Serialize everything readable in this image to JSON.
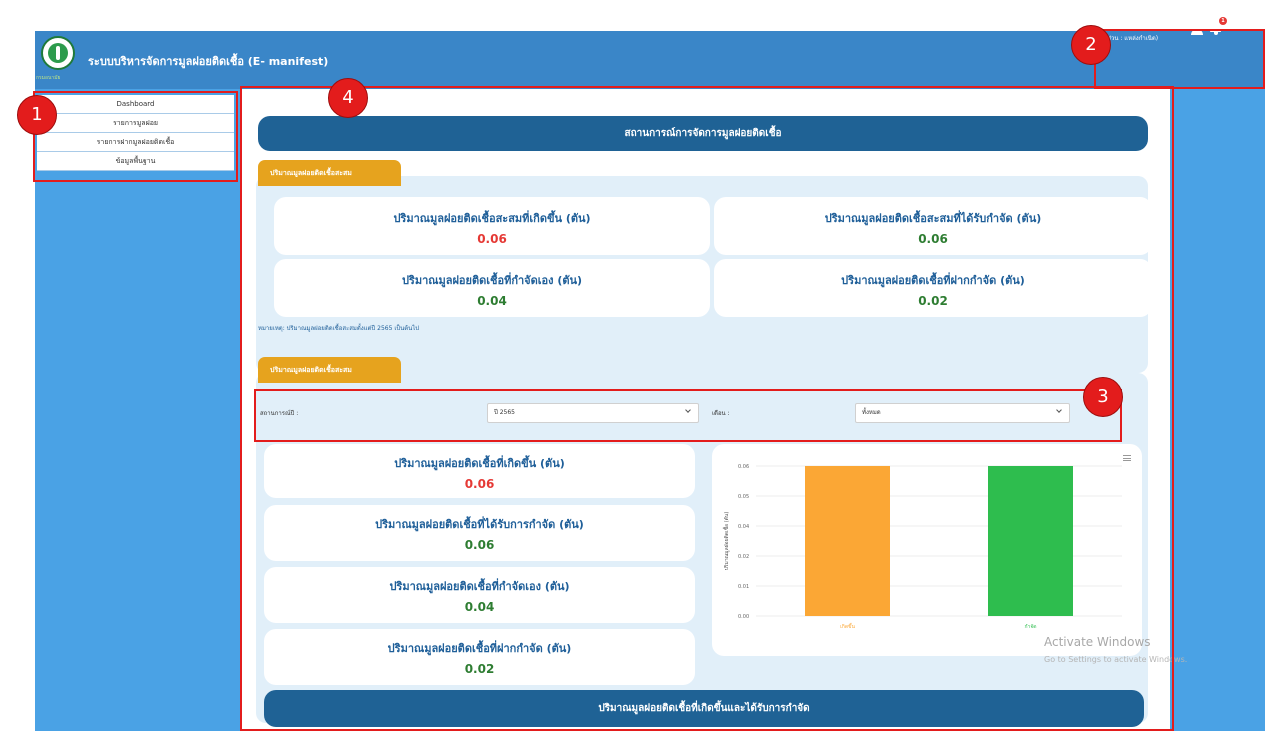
{
  "header": {
    "title": "ระบบบริหารจัดการมูลฝอยติดเชื้อ (E- manifest)",
    "logo_caption": "กรมอนามัย",
    "user_role": "STAFF",
    "user_dept": "(ส่วน : แหล่งกำเนิด)",
    "notification_count": "1"
  },
  "sidebar": {
    "items": [
      {
        "label": "Dashboard"
      },
      {
        "label": "รายการมูลฝอย"
      },
      {
        "label": "รายการฝากมูลฝอยติดเชื้อ"
      },
      {
        "label": "ข้อมูลพื้นฐาน"
      }
    ]
  },
  "main": {
    "banner_title": "สถานการณ์การจัดการมูลฝอยติดเชื้อ",
    "accumulated": {
      "tab_label": "ปริมาณมูลฝอยติดเชื้อสะสม",
      "cards": [
        {
          "label": "ปริมาณมูลฝอยติดเชื้อสะสมที่เกิดขึ้น (ตัน)",
          "value": "0.06"
        },
        {
          "label": "ปริมาณมูลฝอยติดเชื้อสะสมที่ได้รับกำจัด (ตัน)",
          "value": "0.06"
        },
        {
          "label": "ปริมาณมูลฝอยติดเชื้อที่กำจัดเอง (ตัน)",
          "value": "0.04"
        },
        {
          "label": "ปริมาณมูลฝอยติดเชื้อที่ฝากกำจัด (ตัน)",
          "value": "0.02"
        }
      ],
      "note": "หมายเหตุ: ปริมาณมูลฝอยติดเชื้อสะสมตั้งแต่ปี 2565 เป็นต้นไป"
    },
    "monthly": {
      "tab_label": "ปริมาณมูลฝอยติดเชื้อสะสม",
      "filter": {
        "year_label": "สถานการณ์ปี :",
        "year_value": "ปี 2565",
        "month_label": "เดือน :",
        "month_value": "ทั้งหมด"
      },
      "cards": [
        {
          "label": "ปริมาณมูลฝอยติดเชื้อที่เกิดขึ้น (ตัน)",
          "value": "0.06"
        },
        {
          "label": "ปริมาณมูลฝอยติดเชื้อที่ได้รับการกำจัด (ตัน)",
          "value": "0.06"
        },
        {
          "label": "ปริมาณมูลฝอยติดเชื้อที่กำจัดเอง (ตัน)",
          "value": "0.04"
        },
        {
          "label": "ปริมาณมูลฝอยติดเชื้อที่ฝากกำจัด (ตัน)",
          "value": "0.02"
        }
      ]
    },
    "bottom_banner": "ปริมาณมูลฝอยติดเชื้อที่เกิดขึ้นและได้รับการกำจัด"
  },
  "chart_data": {
    "type": "bar",
    "categories": [
      "เกิดขึ้น",
      "กำจัด"
    ],
    "values": [
      0.06,
      0.06
    ],
    "colors": [
      "#fba735",
      "#2ebd4e"
    ],
    "ylabel": "ปริมาณมูลฝอยติดเชื้อ (ตัน)",
    "ylim": [
      0,
      0.06
    ],
    "yticks": [
      "0.06",
      "0.05",
      "0.04",
      "0.02",
      "0.01",
      "0.00"
    ],
    "grid": true
  },
  "watermark": {
    "line1": "Activate Windows",
    "line2": "Go to Settings to activate Windows."
  },
  "annotations": {
    "marker1": "1",
    "marker2": "2",
    "marker3": "3",
    "marker4": "4"
  },
  "colors": {
    "header": "#3a86c8",
    "sidebar": "#4aa2e5",
    "banner": "#1f6295",
    "tab": "#e6a31e",
    "value_red": "#e53935",
    "value_green": "#2e7d32",
    "highlight": "#e31c1c"
  }
}
